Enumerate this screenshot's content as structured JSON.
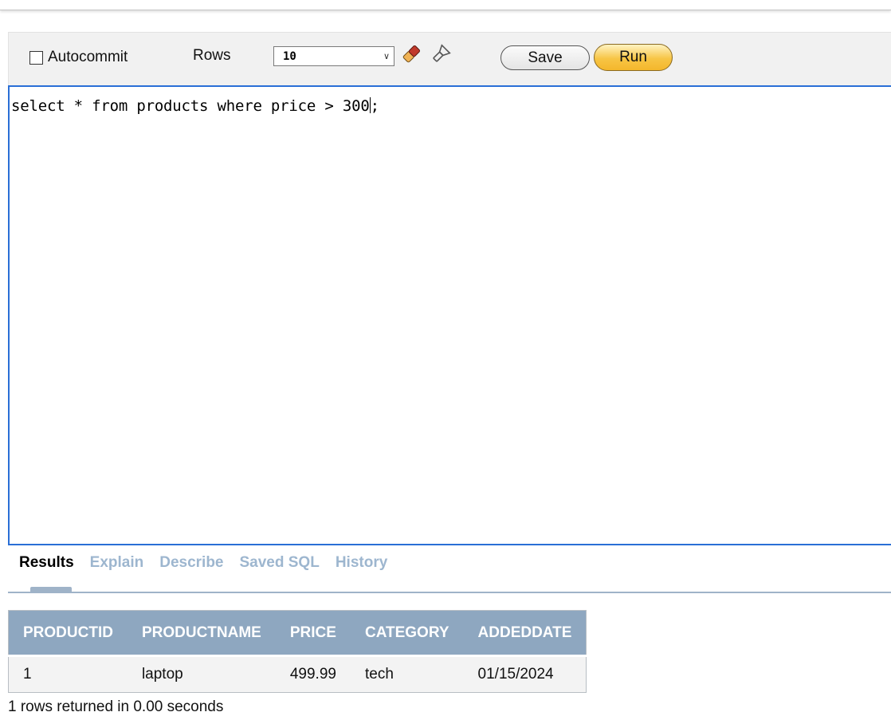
{
  "toolbar": {
    "autocommit_label": "Autocommit",
    "autocommit_checked": false,
    "rows_label": "Rows",
    "rows_value": "10",
    "clear_icon": "eraser-icon",
    "find_icon": "flashlight-icon",
    "save_label": "Save",
    "run_label": "Run"
  },
  "editor": {
    "sql_before_caret": "select * from products where price > 300",
    "sql_after_caret": ";"
  },
  "tabs": [
    {
      "label": "Results",
      "active": true
    },
    {
      "label": "Explain",
      "active": false
    },
    {
      "label": "Describe",
      "active": false
    },
    {
      "label": "Saved SQL",
      "active": false
    },
    {
      "label": "History",
      "active": false
    }
  ],
  "results": {
    "columns": [
      "PRODUCTID",
      "PRODUCTNAME",
      "PRICE",
      "CATEGORY",
      "ADDEDDATE"
    ],
    "rows": [
      [
        "1",
        "laptop",
        "499.99",
        "tech",
        "01/15/2024"
      ]
    ],
    "status": "1 rows returned in 0.00 seconds"
  },
  "colors": {
    "accent_blue": "#2a6fd6",
    "header_bg": "#8ea7c0",
    "run_button": "#f7c545",
    "inactive_tab": "#9db6cf"
  }
}
